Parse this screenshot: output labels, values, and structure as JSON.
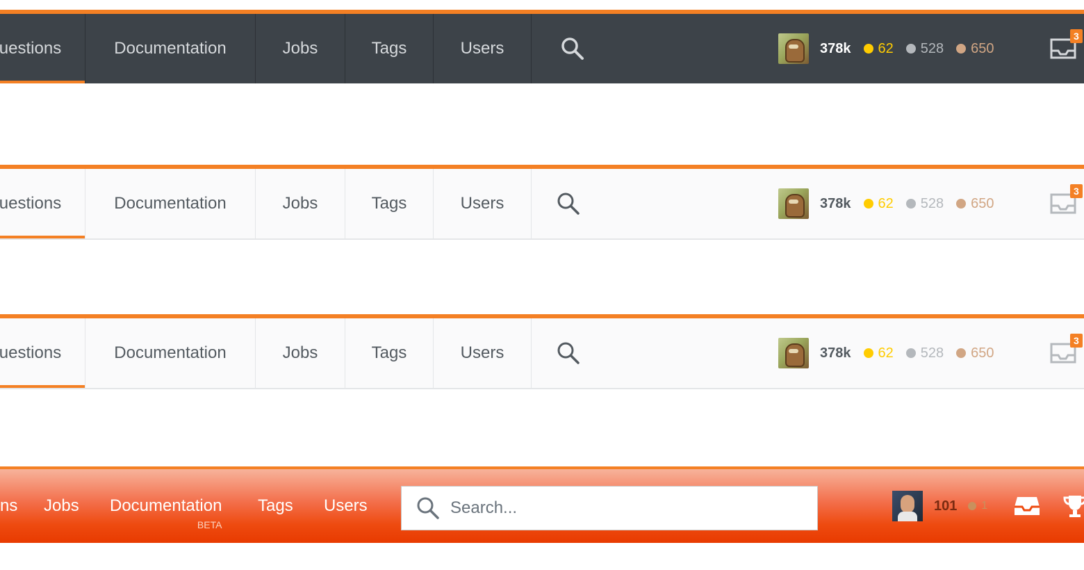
{
  "colors": {
    "accent": "#f48024",
    "dark_bg": "#3d4349",
    "gold": "#ffcc01",
    "silver": "#b4b8bc",
    "bronze": "#d1a684"
  },
  "bar1": {
    "nav": [
      "uestions",
      "Documentation",
      "Jobs",
      "Tags",
      "Users"
    ],
    "user": {
      "rep": "378k",
      "gold": "62",
      "silver": "528",
      "bronze": "650",
      "inbox_count": "3"
    }
  },
  "bar2": {
    "nav": [
      "uestions",
      "Documentation",
      "Jobs",
      "Tags",
      "Users"
    ],
    "user": {
      "rep": "378k",
      "gold": "62",
      "silver": "528",
      "bronze": "650",
      "inbox_count": "3"
    }
  },
  "bar3": {
    "nav": [
      "uestions",
      "Documentation",
      "Jobs",
      "Tags",
      "Users"
    ],
    "user": {
      "rep": "378k",
      "gold": "62",
      "silver": "528",
      "bronze": "650",
      "inbox_count": "3"
    }
  },
  "bar4": {
    "nav": [
      "ns",
      "Jobs",
      "Documentation",
      "Tags",
      "Users"
    ],
    "beta_label": "BETA",
    "search_placeholder": "Search...",
    "user": {
      "rep": "101",
      "bronze": "1"
    }
  }
}
